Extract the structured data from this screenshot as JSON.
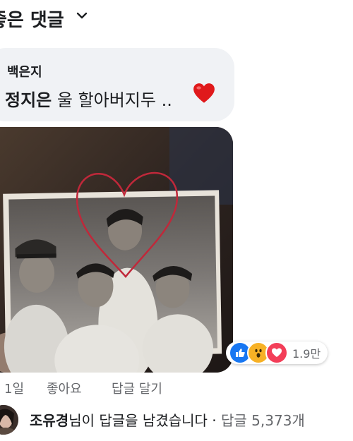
{
  "header": {
    "title": "좋은 댓글",
    "chevron_icon": "chevron-down-icon"
  },
  "comment": {
    "author": "백은지",
    "mention": "정지은",
    "text": "울 할아버지두 ..",
    "emoji_icon": "red-heart-icon"
  },
  "reactions": {
    "icons": [
      "like-icon",
      "wow-icon",
      "love-icon"
    ],
    "count": "1.9만"
  },
  "actions": {
    "time": "1일",
    "like": "좋아요",
    "reply": "답글 달기"
  },
  "reply_summary": {
    "name": "조유경",
    "text": "님이 답글을 남겼습니다 · ",
    "count": "답글 5,373개"
  },
  "colors": {
    "like_blue": "#1877f2",
    "love_red": "#f33e58",
    "wow_yellow": "#f7b125",
    "heart_red": "#e0191b",
    "drawn_heart": "#c0283a"
  }
}
